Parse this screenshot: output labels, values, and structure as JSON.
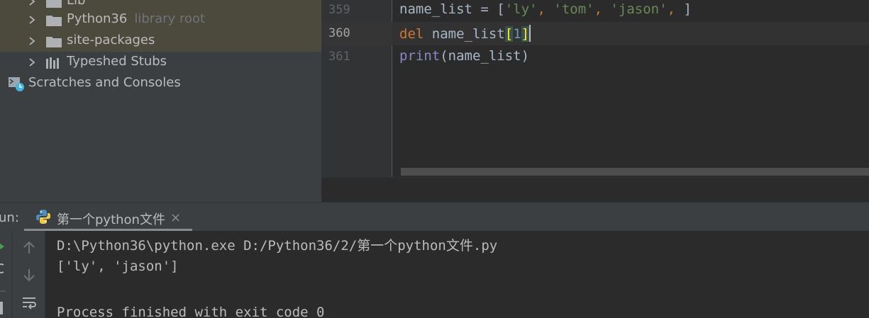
{
  "project_tree": {
    "items": [
      {
        "label": "Lib",
        "hint": ""
      },
      {
        "label": "Python36",
        "hint": "library root"
      },
      {
        "label": "site-packages",
        "hint": ""
      },
      {
        "label": "Typeshed Stubs",
        "hint": ""
      },
      {
        "label": "Scratches and Consoles",
        "hint": ""
      }
    ]
  },
  "editor": {
    "line_numbers": [
      "359",
      "360",
      "361"
    ],
    "lines": [
      {
        "var": "name_list",
        "eq": " = ",
        "open": "[",
        "s1": "'ly'",
        "c1": ", ",
        "s2": "'tom'",
        "c2": ", ",
        "s3": "'jason'",
        "c3": ", ",
        "close": "]"
      },
      {
        "kw": "del",
        "sp": " ",
        "var": "name_list",
        "open": "[",
        "num": "1",
        "close": "]"
      },
      {
        "fn": "print",
        "args": "(name_list)"
      }
    ]
  },
  "run": {
    "title": "un:",
    "tab_label": "第一个python文件",
    "close_glyph": "×",
    "console_lines": [
      "D:\\Python36\\python.exe D:/Python36/2/第一个python文件.py",
      "['ly', 'jason']",
      "",
      "Process finished with exit code 0"
    ]
  },
  "icons": {
    "run_tab": "python-icon",
    "up": "arrow-up-icon",
    "down": "arrow-down-icon",
    "wrap": "soft-wrap-icon",
    "scratches": "scratches-icon"
  },
  "colors": {
    "editor_bg": "#2b2b2b",
    "panel_bg": "#3c3f41",
    "keyword": "#cc7832",
    "string": "#6a8759",
    "number": "#6897bb",
    "builtin": "#8888c6"
  }
}
